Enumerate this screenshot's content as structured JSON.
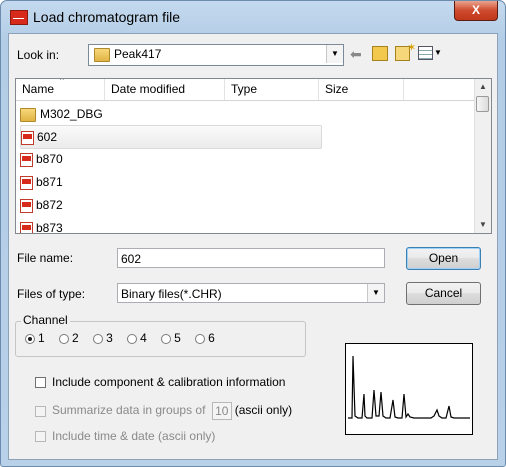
{
  "window": {
    "title": "Load chromatogram file",
    "close_glyph": "X"
  },
  "lookin": {
    "label": "Look in:",
    "value": "Peak417",
    "icons": [
      "back-arrow-icon",
      "up-folder-icon",
      "new-folder-icon",
      "view-menu-icon"
    ]
  },
  "filelist": {
    "columns": [
      "Name",
      "Date modified",
      "Type",
      "Size"
    ],
    "items": [
      {
        "name": "M302_DBG",
        "icon": "folder-icon",
        "selected": false
      },
      {
        "name": "602",
        "icon": "chr-file-icon",
        "selected": true
      },
      {
        "name": "b870",
        "icon": "chr-file-icon",
        "selected": false
      },
      {
        "name": "b871",
        "icon": "chr-file-icon",
        "selected": false
      },
      {
        "name": "b872",
        "icon": "chr-file-icon",
        "selected": false
      },
      {
        "name": "b873",
        "icon": "chr-file-icon",
        "selected": false
      }
    ]
  },
  "filename": {
    "label": "File name:",
    "value": "602"
  },
  "filetype": {
    "label": "Files of type:",
    "value": "Binary files(*.CHR)"
  },
  "buttons": {
    "open": "Open",
    "cancel": "Cancel"
  },
  "channel": {
    "label": "Channel",
    "options": [
      "1",
      "2",
      "3",
      "4",
      "5",
      "6"
    ],
    "selected": "1"
  },
  "options": {
    "include_component": "Include component & calibration information",
    "summarize_prefix": "Summarize data in groups of",
    "summarize_value": "10",
    "summarize_suffix": "(ascii only)",
    "include_time": "Include time & date (ascii only)"
  },
  "colors": {
    "titlebar": "#b8d0e8",
    "close": "#c0381c",
    "file_icon": "#d82a1a",
    "folder": "#e1b445"
  }
}
